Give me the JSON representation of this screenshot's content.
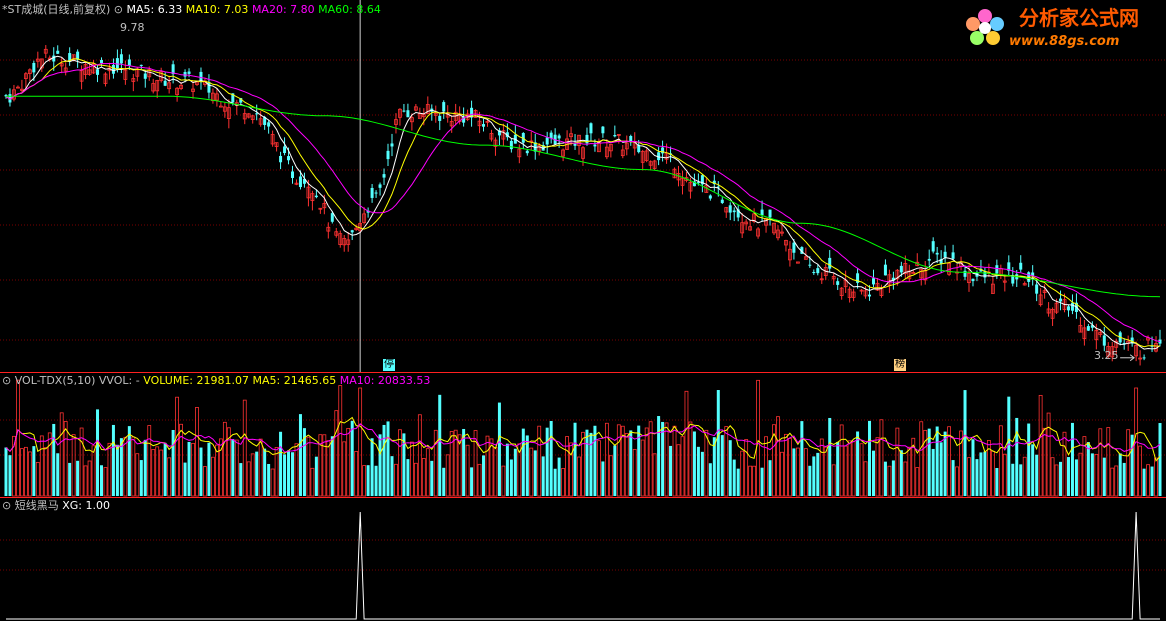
{
  "colors": {
    "up": "#ff3232",
    "down": "#54ffff",
    "ma5": "#ffffff",
    "ma10": "#ffff00",
    "ma20": "#ff00ff",
    "ma60": "#00ff00",
    "grid": "#7a0000",
    "divider": "#ff2020",
    "text": "#c0c0c0"
  },
  "header": {
    "title": "*ST成城(日线,前复权)",
    "ma5": "MA5: 6.33",
    "ma10": "MA10: 7.03",
    "ma20": "MA20: 7.80",
    "ma60": "MA60: 8.64"
  },
  "vol_header": {
    "name": "VOL-TDX(5,10)",
    "vvol": "VVOL: -",
    "volume": "VOLUME: 21981.07",
    "ma5": "MA5: 21465.65",
    "ma10": "MA10: 20833.53"
  },
  "xg_header": {
    "name": "短线黑马",
    "xg": "XG: 1.00"
  },
  "annotations": {
    "high": "9.78",
    "low": "3.25",
    "mark_stop": "停",
    "mark_rank": "榜"
  },
  "watermark": {
    "text": "分析家公式网",
    "url": "www.88gs.com"
  },
  "chart_data": [
    {
      "type": "candlestick",
      "title": "*ST成城(日线,前复权)",
      "series_names": [
        "MA5",
        "MA10",
        "MA20",
        "MA60"
      ],
      "last_values": {
        "MA5": 6.33,
        "MA10": 7.03,
        "MA20": 7.8,
        "MA60": 8.64
      },
      "annotated_high": 9.78,
      "annotated_low": 3.25,
      "close_trend_keypoints": [
        [
          0,
          8.6
        ],
        [
          10,
          9.4
        ],
        [
          25,
          9.2
        ],
        [
          45,
          8.9
        ],
        [
          60,
          8.4
        ],
        [
          75,
          6.9
        ],
        [
          85,
          5.6
        ],
        [
          92,
          6.4
        ],
        [
          100,
          8.3
        ],
        [
          115,
          8.2
        ],
        [
          130,
          7.6
        ],
        [
          150,
          7.7
        ],
        [
          165,
          7.4
        ],
        [
          175,
          6.7
        ],
        [
          190,
          6.0
        ],
        [
          205,
          5.0
        ],
        [
          215,
          4.6
        ],
        [
          225,
          5.0
        ],
        [
          235,
          5.3
        ],
        [
          245,
          4.9
        ],
        [
          255,
          4.9
        ],
        [
          265,
          4.3
        ],
        [
          278,
          3.6
        ],
        [
          285,
          3.4
        ],
        [
          290,
          3.7
        ]
      ],
      "ma60_keypoints": [
        [
          0,
          8.6
        ],
        [
          40,
          8.6
        ],
        [
          80,
          8.2
        ],
        [
          120,
          7.6
        ],
        [
          160,
          7.1
        ],
        [
          200,
          6.0
        ],
        [
          240,
          5.0
        ],
        [
          290,
          4.5
        ]
      ]
    },
    {
      "type": "bar",
      "title": "VOL-TDX(5,10)",
      "last_values": {
        "VOLUME": 21981.07,
        "MA5": 21465.65,
        "MA10": 20833.53
      },
      "note": "daily volume bars, red on up days, cyan on down days"
    },
    {
      "type": "line",
      "title": "短线黑马",
      "last_values": {
        "XG": 1.0
      },
      "signal_days": [
        89,
        284
      ]
    }
  ]
}
